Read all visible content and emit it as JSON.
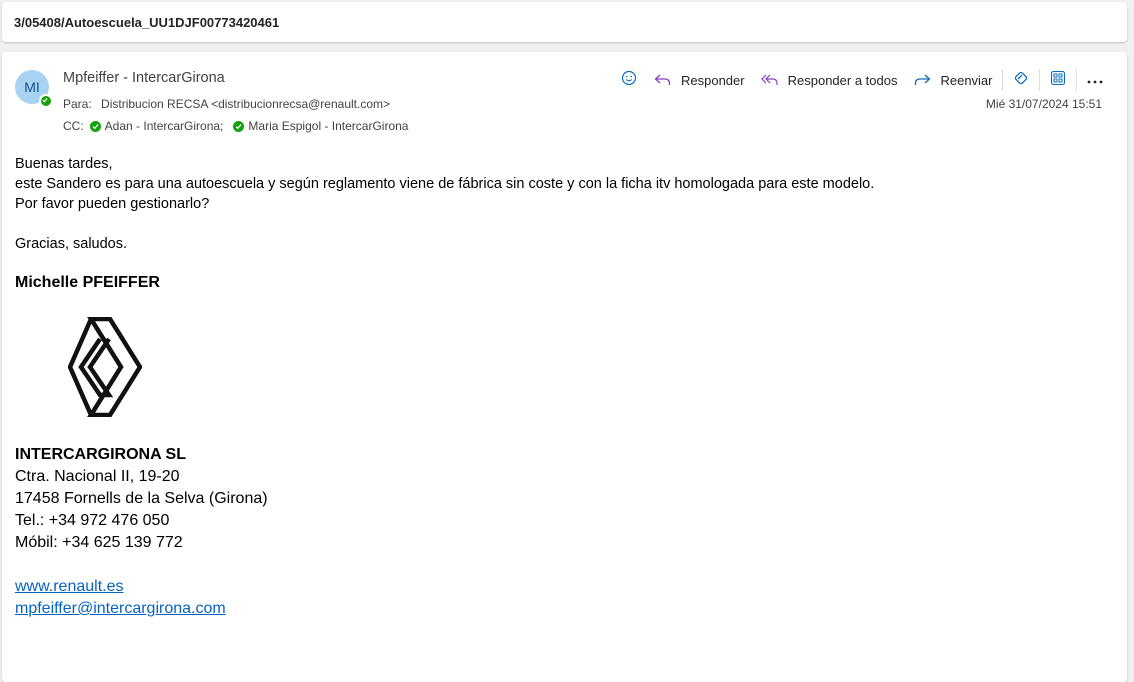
{
  "subject": "3/05408/Autoescuela_UU1DJF00773420461",
  "message": {
    "avatar_initials": "MI",
    "sender": "Mpfeiffer - IntercarGirona",
    "to_label": "Para:",
    "to_value": "Distribucion RECSA <distribucionrecsa@renault.com>",
    "cc_label": "CC:",
    "cc": [
      {
        "name": "Adan - IntercarGirona;"
      },
      {
        "name": "Maria Espigol - IntercarGirona"
      }
    ],
    "date": "Mié 31/07/2024 15:51"
  },
  "toolbar": {
    "reply": "Responder",
    "reply_all": "Responder a todos",
    "forward": "Reenviar",
    "icons": [
      "emoji-icon",
      "reply-icon",
      "reply-all-icon",
      "forward-icon",
      "loop-icon",
      "apps-icon",
      "more-icon"
    ]
  },
  "body": {
    "line1": "Buenas tardes,",
    "line2": "este Sandero es para una autoescuela y según reglamento viene de fábrica sin coste y con la ficha itv homologada para este modelo.",
    "line3": "Por favor pueden gestionarlo?",
    "line4": "Gracias, saludos."
  },
  "signature": {
    "name": "Michelle PFEIFFER",
    "logo": "renault-logo",
    "company": "INTERCARGIRONA SL",
    "address1": "Ctra. Nacional II, 19-20",
    "address2": "17458 Fornells de la Selva (Girona)",
    "tel": "Tel.: +34 972 476 050",
    "mobile": "Móbil: +34 625 139 772",
    "web": "www.renault.es",
    "email": "mpfeiffer@intercargirona.com"
  },
  "colors": {
    "accent": "#0f6cbd",
    "reply_icon": "#8a3fb8",
    "presence": "#13a10e",
    "link": "#0563c1"
  }
}
